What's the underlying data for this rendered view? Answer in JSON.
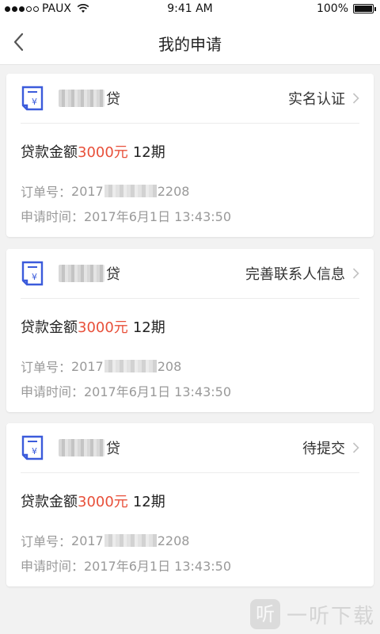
{
  "status_bar": {
    "carrier": "PAUX",
    "time": "9:41 AM",
    "battery": "100%",
    "battery_level": 1.0
  },
  "nav": {
    "title": "我的申请"
  },
  "applications": [
    {
      "app_suffix": "贷",
      "status": "实名认证",
      "amount_label": "贷款金额",
      "amount": "3000元",
      "period": "12期",
      "order_label": "订单号：",
      "order_prefix": "2017",
      "order_suffix": "2208",
      "time_text": "申请时间：2017年6月1日 13:43:50"
    },
    {
      "app_suffix": "贷",
      "status": "完善联系人信息",
      "amount_label": "贷款金额",
      "amount": "3000元",
      "period": "12期",
      "order_label": "订单号：",
      "order_prefix": "2017",
      "order_suffix": "208",
      "time_text": "申请时间：2017年6月1日 13:43:50"
    },
    {
      "app_suffix": "贷",
      "status": "待提交",
      "amount_label": "贷款金额",
      "amount": "3000元",
      "period": "12期",
      "order_label": "订单号：",
      "order_prefix": "2017",
      "order_suffix": "2208",
      "time_text": "申请时间：2017年6月1日 13:43:50"
    }
  ],
  "watermark": {
    "logo_glyph": "听",
    "text": "一听下载"
  },
  "colors": {
    "accent_red": "#e8503a",
    "icon_blue": "#3b5bdb"
  }
}
